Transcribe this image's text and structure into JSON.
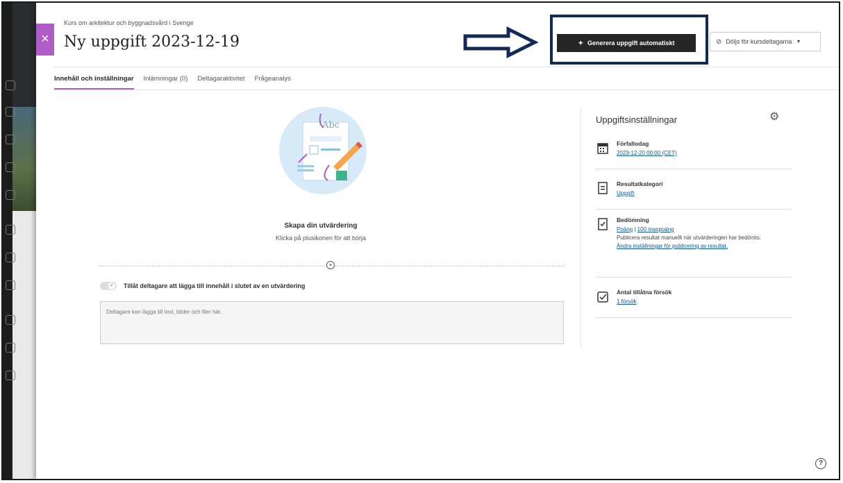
{
  "header": {
    "breadcrumb": "Kurs om arkitektur och byggnadsvård i Svenge",
    "title": "Ny uppgift 2023-12-19",
    "generate_button": "Generera uppgift automatiskt",
    "visibility_button": "Döljs för kursdeltagarna"
  },
  "tabs": [
    {
      "label": "Innehåll och inställningar"
    },
    {
      "label": "Inlämningar (0)"
    },
    {
      "label": "Deltagaraktivitet"
    },
    {
      "label": "Frågeanalys"
    }
  ],
  "main": {
    "empty_title": "Skapa din utvärdering",
    "empty_subtitle": "Klicka på plusikonen för att börja",
    "illustration_text": "Abc",
    "toggle_label": "Tillåt deltagare att lägga till innehåll i slutet av en utvärdering",
    "textarea_placeholder": "Deltagare kan lägga till text, bilder och filer här."
  },
  "settings": {
    "title": "Uppgiftsinställningar",
    "due": {
      "label": "Förfallodag",
      "value": "2023-12-20 00:00 (CET)"
    },
    "category": {
      "label": "Resultatkategori",
      "value": "Uppgift"
    },
    "grading": {
      "label": "Bedömning",
      "scheme": "Poäng",
      "max": "100 maxpoäng",
      "note": "Publicera resultat manuellt när utvärderingen har bedömts.",
      "link": "Ändra inställningar för publicering av resultat."
    },
    "attempts": {
      "label": "Antal tillåtna försök",
      "value": "1 försök"
    }
  },
  "colors": {
    "accent": "#b05cc8",
    "highlight": "#132a57",
    "button": "#262626",
    "link": "#0a5a9e"
  }
}
